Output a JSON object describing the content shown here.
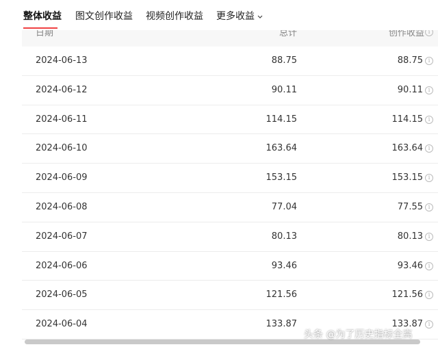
{
  "tabs": [
    "整体收益",
    "图文创作收益",
    "视频创作收益",
    "更多收益"
  ],
  "table": {
    "headers": {
      "date": "日期",
      "total": "总计",
      "creation": "创作收益"
    },
    "rows": [
      {
        "date": "2024-06-13",
        "total": "88.75",
        "creation": "88.75"
      },
      {
        "date": "2024-06-12",
        "total": "90.11",
        "creation": "90.11"
      },
      {
        "date": "2024-06-11",
        "total": "114.15",
        "creation": "114.15"
      },
      {
        "date": "2024-06-10",
        "total": "163.64",
        "creation": "163.64"
      },
      {
        "date": "2024-06-09",
        "total": "153.15",
        "creation": "153.15"
      },
      {
        "date": "2024-06-08",
        "total": "77.04",
        "creation": "77.55"
      },
      {
        "date": "2024-06-07",
        "total": "80.13",
        "creation": "80.13"
      },
      {
        "date": "2024-06-06",
        "total": "93.46",
        "creation": "93.46"
      },
      {
        "date": "2024-06-05",
        "total": "121.56",
        "creation": "121.56"
      },
      {
        "date": "2024-06-04",
        "total": "133.87",
        "creation": "133.87"
      }
    ]
  },
  "info_icon_glyph": "i",
  "watermark": "头条 @为了历史指标全高",
  "colors": {
    "accent": "#f04142",
    "header_bg": "#f7f7f7"
  }
}
